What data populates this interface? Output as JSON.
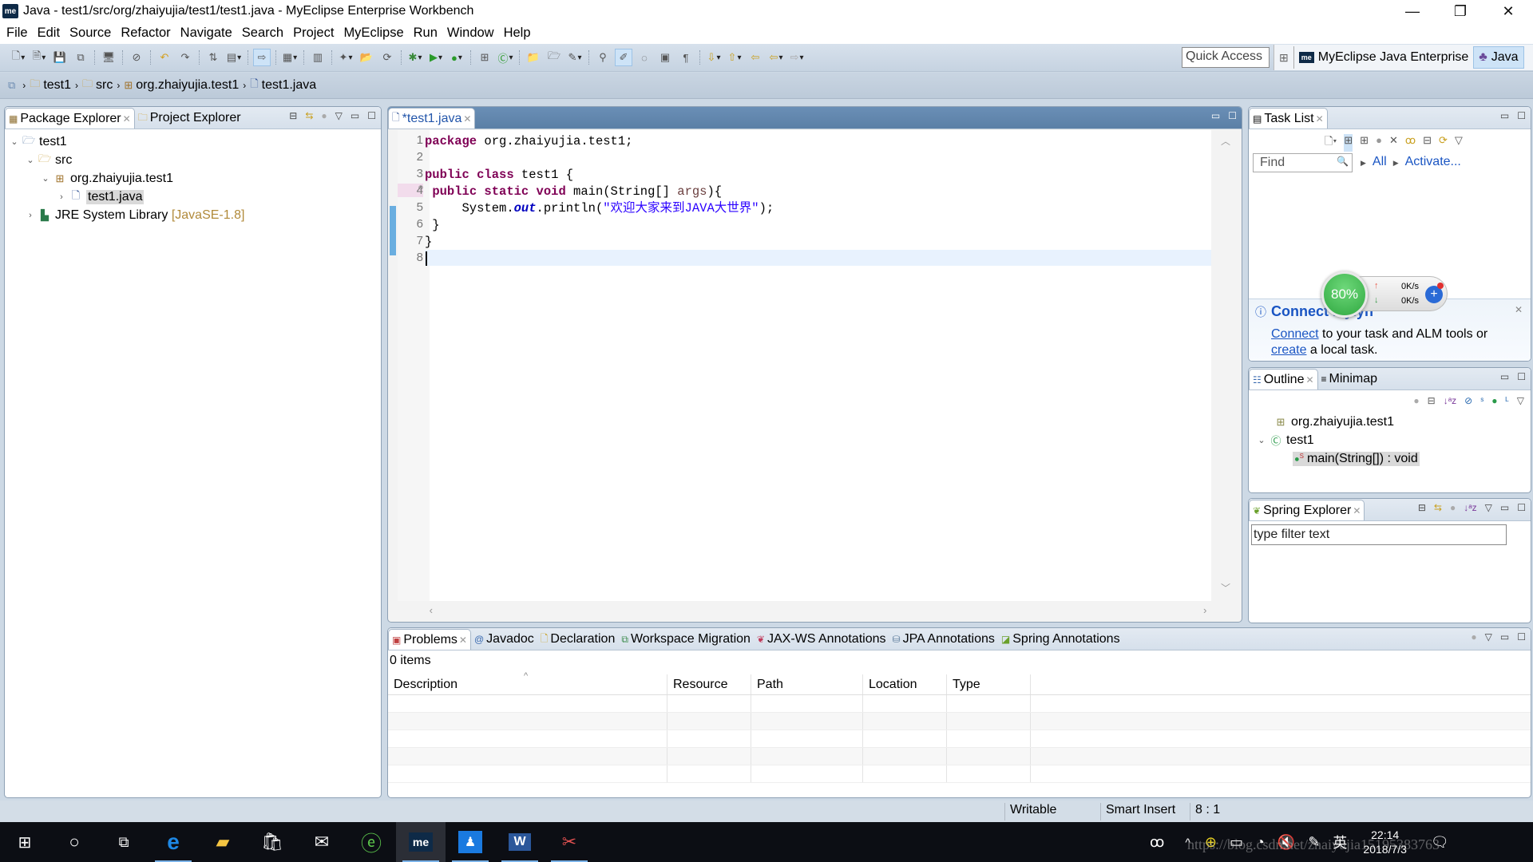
{
  "window": {
    "title": "Java - test1/src/org/zhaiyujia/test1/test1.java - MyEclipse Enterprise Workbench",
    "app_logo": "me",
    "controls": {
      "minimize": "—",
      "restore": "❐",
      "close": "✕"
    }
  },
  "menu": [
    "File",
    "Edit",
    "Source",
    "Refactor",
    "Navigate",
    "Search",
    "Project",
    "MyEclipse",
    "Run",
    "Window",
    "Help"
  ],
  "toolbar": {
    "quick_access_placeholder": "Quick Access",
    "perspectives": [
      {
        "icon": "me",
        "label": "MyEclipse Java Enterprise",
        "active": false
      },
      {
        "icon": "java-perspective-icon",
        "label": "Java",
        "active": true
      }
    ]
  },
  "breadcrumb": [
    "test1",
    "src",
    "org.zhaiyujia.test1",
    "test1.java"
  ],
  "package_explorer": {
    "tabs": [
      {
        "label": "Package Explorer",
        "active": true
      },
      {
        "label": "Project Explorer",
        "active": false
      }
    ],
    "tree": [
      {
        "label": "test1",
        "icon": "project-icon",
        "expanded": true,
        "level": 0
      },
      {
        "label": "src",
        "icon": "source-folder-icon",
        "expanded": true,
        "level": 1
      },
      {
        "label": "org.zhaiyujia.test1",
        "icon": "package-icon",
        "expanded": true,
        "level": 2
      },
      {
        "label": "test1.java",
        "icon": "java-file-icon",
        "expanded": false,
        "level": 3,
        "selected": true
      },
      {
        "label": "JRE System Library",
        "suffix": "[JavaSE-1.8]",
        "icon": "library-icon",
        "expanded": false,
        "level": 1
      }
    ]
  },
  "editor": {
    "tab_label": "*test1.java",
    "lines": [
      {
        "n": "1",
        "code": "package org.zhaiyujia.test1;"
      },
      {
        "n": "2",
        "code": ""
      },
      {
        "n": "3",
        "code": "public class test1 {"
      },
      {
        "n": "4",
        "code": " public static void main(String[] args){"
      },
      {
        "n": "5",
        "code": "     System.out.println(\"欢迎大家来到JAVA大世界\");"
      },
      {
        "n": "6",
        "code": " }"
      },
      {
        "n": "7",
        "code": "}"
      },
      {
        "n": "8",
        "code": ""
      }
    ],
    "cursor_line": 8
  },
  "task_list": {
    "tab_label": "Task List",
    "find_placeholder": "Find",
    "filters": [
      "All",
      "Activate..."
    ],
    "connect": {
      "title": "Connect Mylyn",
      "link1": "Connect",
      "text1": " to your task and ALM tools or",
      "link2": "create",
      "text2": " a local task."
    }
  },
  "net_widget": {
    "percent": "80%",
    "up": "0K/s",
    "down": "0K/s"
  },
  "outline": {
    "tabs": [
      {
        "label": "Outline",
        "active": true
      },
      {
        "label": "Minimap",
        "active": false
      }
    ],
    "items": [
      {
        "label": "org.zhaiyujia.test1",
        "icon": "package-icon",
        "level": 0
      },
      {
        "label": "test1",
        "icon": "class-icon",
        "level": 0,
        "expanded": true
      },
      {
        "label": "main(String[]) : void",
        "icon": "public-static-method-icon",
        "level": 1,
        "selected": true
      }
    ]
  },
  "spring_explorer": {
    "tab_label": "Spring Explorer",
    "filter_placeholder": "type filter text"
  },
  "problems": {
    "tabs": [
      "Problems",
      "Javadoc",
      "Declaration",
      "Workspace Migration",
      "JAX-WS Annotations",
      "JPA Annotations",
      "Spring Annotations"
    ],
    "count": "0 items",
    "columns": [
      "Description",
      "Resource",
      "Path",
      "Location",
      "Type"
    ]
  },
  "status": {
    "writable": "Writable",
    "insert_mode": "Smart Insert",
    "position": "8 : 1"
  },
  "taskbar": {
    "apps": [
      "start",
      "cortana",
      "task-view",
      "edge",
      "file-explorer",
      "store",
      "mail",
      "360-browser",
      "myeclipse",
      "qq",
      "word",
      "snipping"
    ],
    "time": "22:14",
    "date": "2018/7/3",
    "ime": "英",
    "watermark": "https://blog.csdn.net/zhaiyujia15195383763"
  }
}
